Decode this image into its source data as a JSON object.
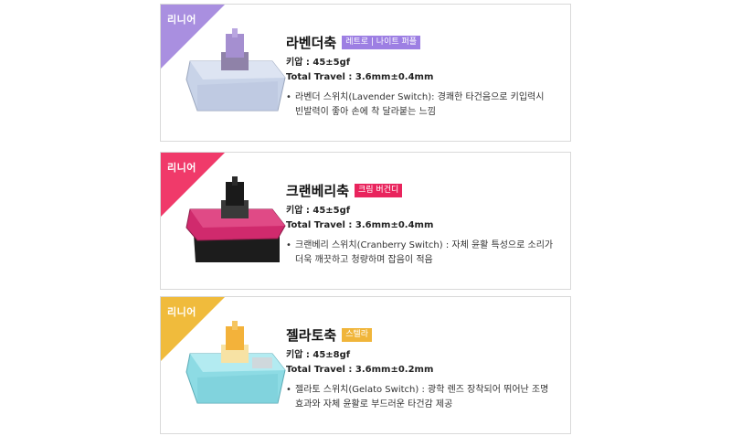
{
  "cards": [
    {
      "ribbon": "리니어",
      "ribbon_color": "#a98fe0",
      "name": "라벤더축",
      "badge": "레트로 | 나이트 퍼플",
      "badge_color": "#9d7fe3",
      "force": "키압 : 45±5gf",
      "travel": "Total Travel : 3.6mm±0.4mm",
      "bullet": "•",
      "desc_line1": "라벤더 스위치(Lavender Switch): 경쾌한 타건음으로 키입력시",
      "desc_line2": "빈발력이 좋아 손에 착 달라붙는 느낌",
      "stem_color": "#a58fd0",
      "housing_color": "#c8d3e8"
    },
    {
      "ribbon": "리니어",
      "ribbon_color": "#f03a6a",
      "name": "크랜베리축",
      "badge": "크림 버건디",
      "badge_color": "#e9245d",
      "force": "키압 : 45±5gf",
      "travel": "Total Travel : 3.6mm±0.4mm",
      "bullet": "•",
      "desc_line1": "크랜베리 스위치(Cranberry Switch) : 자체 윤활 특성으로 소리가",
      "desc_line2": "더욱 깨끗하고 청량하며 잡음이 적음",
      "stem_color": "#1a1a1a",
      "housing_color": "#d02a6d"
    },
    {
      "ribbon": "리니어",
      "ribbon_color": "#f0bb3c",
      "name": "젤라토축",
      "badge": "스텔라",
      "badge_color": "#f0b53a",
      "force": "키압 : 45±8gf",
      "travel": "Total Travel : 3.6mm±0.2mm",
      "bullet": "•",
      "desc_line1": "젤라토 스위치(Gelato Switch) : 광학 렌즈 장착되어 뛰어난 조명",
      "desc_line2": "효과와 자체 윤활로 부드러운 타건감 제공",
      "stem_color": "#f3b23a",
      "housing_color": "#8ddbe4"
    }
  ]
}
